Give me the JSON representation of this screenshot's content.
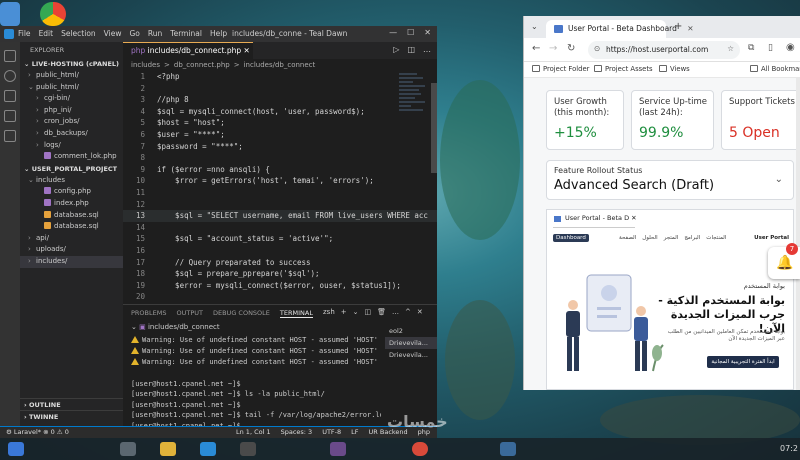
{
  "desktop": {
    "watermark": "خمسات"
  },
  "vscode": {
    "menu": [
      "File",
      "Edit",
      "Selection",
      "View",
      "Go",
      "Run",
      "Terminal",
      "Help"
    ],
    "window_title": "includes/db_conne - Teal Dawn",
    "explorer_title": "EXPLORER",
    "tree": [
      {
        "label": "LIVE-HOSTING (cPANEL)",
        "type": "section"
      },
      {
        "label": "public_html/",
        "type": "folder",
        "depth": 1,
        "open": false
      },
      {
        "label": "public_html/",
        "type": "folder",
        "depth": 1,
        "open": true
      },
      {
        "label": "cgi-bin/",
        "type": "folder",
        "depth": 2,
        "open": false
      },
      {
        "label": "php_ini/",
        "type": "folder",
        "depth": 2,
        "open": false
      },
      {
        "label": "cron_jobs/",
        "type": "folder",
        "depth": 2,
        "open": false
      },
      {
        "label": "db_backups/",
        "type": "folder",
        "depth": 2,
        "open": false
      },
      {
        "label": "logs/",
        "type": "folder",
        "depth": 2,
        "open": false
      },
      {
        "label": "comment_lok.php",
        "type": "file",
        "depth": 2,
        "color": "#a074c4"
      },
      {
        "label": "USER_PORTAL_PROJECT",
        "type": "section"
      },
      {
        "label": "includes",
        "type": "folder",
        "depth": 1,
        "open": true
      },
      {
        "label": "config.php",
        "type": "file",
        "depth": 2,
        "color": "#a074c4"
      },
      {
        "label": "index.php",
        "type": "file",
        "depth": 2,
        "color": "#a074c4"
      },
      {
        "label": "database.sql",
        "type": "file",
        "depth": 2,
        "color": "#e6a23c"
      },
      {
        "label": "database.sql",
        "type": "file",
        "depth": 2,
        "color": "#e6a23c"
      },
      {
        "label": "api/",
        "type": "folder",
        "depth": 1,
        "open": false
      },
      {
        "label": "uploads/",
        "type": "folder",
        "depth": 1,
        "open": false
      },
      {
        "label": "includes/",
        "type": "folder",
        "depth": 1,
        "open": false,
        "selected": true
      }
    ],
    "bottom_sections": [
      "OUTLINE",
      "TWINNE"
    ],
    "active_tab": "includes/db_connect.php",
    "breadcrumbs": [
      "includes",
      ">",
      "db_connect.php",
      ">",
      "includes/db_connect"
    ],
    "code": [
      {
        "n": "1",
        "t": "<?php"
      },
      {
        "n": "2",
        "t": ""
      },
      {
        "n": "3",
        "t": "//php 8"
      },
      {
        "n": "4",
        "t": "$sql = mysqli_connect(host, 'user, password$);"
      },
      {
        "n": "5",
        "t": "$host = \"host\";"
      },
      {
        "n": "6",
        "t": "$user = \"****\";"
      },
      {
        "n": "7",
        "t": "$password = \"****\";"
      },
      {
        "n": "8",
        "t": ""
      },
      {
        "n": "9",
        "t": "if ($error =nno ansqli) {"
      },
      {
        "n": "10",
        "t": "    $rror = getErrors('host', temai', 'errors');"
      },
      {
        "n": "11",
        "t": ""
      },
      {
        "n": "12",
        "t": ""
      },
      {
        "n": "13",
        "t": "    $sql = \"SELECT username, email FROM live_users WHERE acc"
      },
      {
        "n": "14",
        "t": ""
      },
      {
        "n": "15",
        "t": "    $sql = \"account_status = 'active'\";"
      },
      {
        "n": "16",
        "t": ""
      },
      {
        "n": "17",
        "t": "    // Query preparated to success"
      },
      {
        "n": "18",
        "t": "    $sql = prepare_ppreparе('$sql');"
      },
      {
        "n": "19",
        "t": "    $error = mysqli_connect($error, ouser, $status1]);"
      },
      {
        "n": "20",
        "t": ""
      },
      {
        "n": "21",
        "t": "    if ($ermote_error(use)) {"
      }
    ],
    "panel_tabs": [
      "PROBLEMS",
      "OUTPUT",
      "DEBUG CONSOLE",
      "TERMINAL"
    ],
    "panel_active": "TERMINAL",
    "panel_actions": [
      "zsh",
      "+",
      "⌄",
      "◫",
      "🗑",
      "…",
      "^",
      "✕"
    ],
    "panel_file": "includes/db_connect",
    "warnings": [
      "Warning: Use of undefined constant HOST - assumed 'HOST' (pr...",
      "Warning: Use of undefined constant HOST - assumed 'HOST' (pr...",
      "Warning: Use of undefined constant HOST - assumed 'HOST' (pr..."
    ],
    "terminal": [
      "",
      "[user@host1.cpanel.net ~]$",
      "[user@host1.cpanel.net ~]$ ls -la public_html/",
      "[user@host1.cpanel.net ~]$",
      "[user@host1.cpanel.net ~]$ tail -f /var/log/apache2/error.log",
      "[user@host1.cpanel.net ~]$",
      "[user@host1.cpanel.net ~]$ mysqldump --user=**** --password=*",
      "*** --all-databases > db_backup_full.sql",
      "[user@host1.cpanel.net ~]$"
    ],
    "terminal_list": [
      "eol2",
      "Drievevila...",
      "Drievevila..."
    ],
    "status_left": "⚙ Laravel*  ⊗ 0 ⚠ 0",
    "status_right": [
      "Ln 1, Col 1",
      "Spaces: 3",
      "UTF-8",
      "LF",
      "UR Backend",
      "php"
    ]
  },
  "chrome": {
    "tab_title": "User Portal - Beta Dashboard",
    "url": "https://host.userportal.com",
    "bookmarks": [
      "Project Folder",
      "Project Assets",
      "Views",
      "All Bookmarks"
    ],
    "cards": [
      {
        "label": "User Growth\n(this month):",
        "value": "+15%",
        "color": "#1e8e3e"
      },
      {
        "label": "Service Up-time\n(last 24h):",
        "value": "99.9%",
        "color": "#1e8e3e"
      },
      {
        "label": "Support Tickets",
        "value": "5 Open",
        "color": "#d93025"
      }
    ],
    "feature": {
      "label": "Feature Rollout Status",
      "value": "Advanced Search (Draft)"
    },
    "inner_page": {
      "tab_title": "User Portal - Beta D",
      "dash_button": "Dashboard",
      "nav_links": [
        "الصفحة",
        "الحلول",
        "المتجر",
        "البرامج",
        "المنتجات"
      ],
      "brand": "User Portal",
      "kicker": "بوابة المستخدم",
      "title": "بوابة المستخدم الذكية - جرب الميزات الجديدة الآن!",
      "description": "بوابة المستخدم تمكن العاملين الميدانيين من الطلب عبر الميزات الجديدة الآن",
      "cta": "ابدأ الفترة التجريبية المجانية"
    },
    "notification_count": "7"
  },
  "taskbar": {
    "clock": "07:2"
  }
}
